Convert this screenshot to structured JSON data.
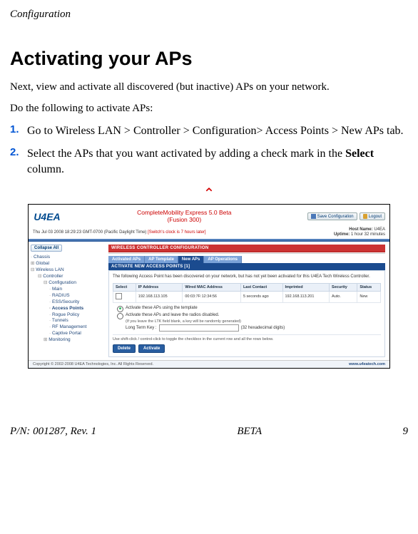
{
  "header": {
    "section_title": "Configuration"
  },
  "content": {
    "heading": "Activating your APs",
    "intro": "Next, view and activate all discovered (but inactive) APs on your network.",
    "lead_in": "Do the following to activate APs:",
    "steps": [
      "Go to Wireless LAN > Controller > Configuration> Access Points > New APs tab.",
      "Select the APs that you want activated by adding a check mark in the Select column."
    ],
    "step_numbers": [
      "1.",
      "2."
    ],
    "bold_word": "Select"
  },
  "screenshot": {
    "logo_text": "U4EA",
    "title_line1": "CompleteMobility Express 5.0 Beta",
    "title_line2": "(Fusion 300)",
    "btn_save": "Save Configuration",
    "btn_logout": "Logout",
    "date_text": "Thu Jul 03 2008 18:29:23 GMT-0700 (Pacific Daylight Time)",
    "clock_note": "[Switch's clock is 7 hours later]",
    "host_label": "Host Name:",
    "host_value": "U4EA",
    "uptime_label": "Uptime:",
    "uptime_value": "1 hour 32 minutes",
    "collapse_btn": "Collapse All",
    "tree": [
      "Chassis",
      "Global",
      "Wireless LAN",
      "Controller",
      "Configuration",
      "Main",
      "RADIUS",
      "ESS/Security",
      "Access Points",
      "Rogue Policy",
      "Tunnels",
      "RF Management",
      "Captive Portal",
      "Monitoring"
    ],
    "panel_title": "WIRELESS CONTROLLER CONFIGURATION",
    "tabs": [
      "Activated APs",
      "AP Template",
      "New APs",
      "AP Operations"
    ],
    "subbar": "ACTIVATE NEW ACCESS POINTS [1]",
    "panel_intro": "The following Access Point has been discovered on your network, but has not yet been activated for this U4EA Tech Wireless Controller.",
    "columns": [
      "Select",
      "IP Address",
      "Wired MAC Address",
      "Last Contact",
      "Imprinted",
      "Security",
      "Status"
    ],
    "row": {
      "ip": "192.168.113.105",
      "mac": "00:03:7F:12:34:56",
      "contact": "5 seconds ago",
      "imprinted": "192.168.113.201",
      "security": "Auto.",
      "status": "New"
    },
    "radio1": "Activate these APs using the template",
    "radio2": "Activate these APs and leave the radios disabled.",
    "ltk_note": "(If you leave the LTK field blank, a key will be randomly generated)",
    "ltk_label": "Long Term Key :",
    "ltk_suffix": "(32 hexadecimal digits)",
    "hint": "Use shift-click / control-click to toggle the checkbox in the current row and all the rows below.",
    "btn_delete": "Delete",
    "btn_activate": "Activate",
    "copyright": "Copyright © 2002-2008 U4EA Technologies, Inc. All Rights Reserved.",
    "footer_url": "www.u4eatech.com"
  },
  "footer": {
    "left": "P/N: 001287, Rev. 1",
    "center": "BETA",
    "right": "9"
  }
}
